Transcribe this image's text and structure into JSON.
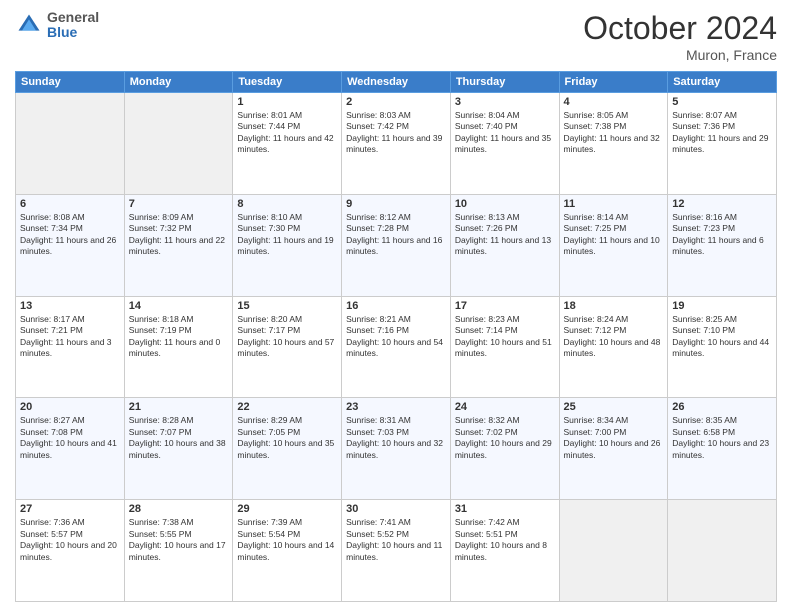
{
  "header": {
    "logo": {
      "general": "General",
      "blue": "Blue"
    },
    "title": "October 2024",
    "location": "Muron, France"
  },
  "weekdays": [
    "Sunday",
    "Monday",
    "Tuesday",
    "Wednesday",
    "Thursday",
    "Friday",
    "Saturday"
  ],
  "weeks": [
    [
      {
        "day": null,
        "sunrise": null,
        "sunset": null,
        "daylight": null
      },
      {
        "day": null,
        "sunrise": null,
        "sunset": null,
        "daylight": null
      },
      {
        "day": "1",
        "sunrise": "Sunrise: 8:01 AM",
        "sunset": "Sunset: 7:44 PM",
        "daylight": "Daylight: 11 hours and 42 minutes."
      },
      {
        "day": "2",
        "sunrise": "Sunrise: 8:03 AM",
        "sunset": "Sunset: 7:42 PM",
        "daylight": "Daylight: 11 hours and 39 minutes."
      },
      {
        "day": "3",
        "sunrise": "Sunrise: 8:04 AM",
        "sunset": "Sunset: 7:40 PM",
        "daylight": "Daylight: 11 hours and 35 minutes."
      },
      {
        "day": "4",
        "sunrise": "Sunrise: 8:05 AM",
        "sunset": "Sunset: 7:38 PM",
        "daylight": "Daylight: 11 hours and 32 minutes."
      },
      {
        "day": "5",
        "sunrise": "Sunrise: 8:07 AM",
        "sunset": "Sunset: 7:36 PM",
        "daylight": "Daylight: 11 hours and 29 minutes."
      }
    ],
    [
      {
        "day": "6",
        "sunrise": "Sunrise: 8:08 AM",
        "sunset": "Sunset: 7:34 PM",
        "daylight": "Daylight: 11 hours and 26 minutes."
      },
      {
        "day": "7",
        "sunrise": "Sunrise: 8:09 AM",
        "sunset": "Sunset: 7:32 PM",
        "daylight": "Daylight: 11 hours and 22 minutes."
      },
      {
        "day": "8",
        "sunrise": "Sunrise: 8:10 AM",
        "sunset": "Sunset: 7:30 PM",
        "daylight": "Daylight: 11 hours and 19 minutes."
      },
      {
        "day": "9",
        "sunrise": "Sunrise: 8:12 AM",
        "sunset": "Sunset: 7:28 PM",
        "daylight": "Daylight: 11 hours and 16 minutes."
      },
      {
        "day": "10",
        "sunrise": "Sunrise: 8:13 AM",
        "sunset": "Sunset: 7:26 PM",
        "daylight": "Daylight: 11 hours and 13 minutes."
      },
      {
        "day": "11",
        "sunrise": "Sunrise: 8:14 AM",
        "sunset": "Sunset: 7:25 PM",
        "daylight": "Daylight: 11 hours and 10 minutes."
      },
      {
        "day": "12",
        "sunrise": "Sunrise: 8:16 AM",
        "sunset": "Sunset: 7:23 PM",
        "daylight": "Daylight: 11 hours and 6 minutes."
      }
    ],
    [
      {
        "day": "13",
        "sunrise": "Sunrise: 8:17 AM",
        "sunset": "Sunset: 7:21 PM",
        "daylight": "Daylight: 11 hours and 3 minutes."
      },
      {
        "day": "14",
        "sunrise": "Sunrise: 8:18 AM",
        "sunset": "Sunset: 7:19 PM",
        "daylight": "Daylight: 11 hours and 0 minutes."
      },
      {
        "day": "15",
        "sunrise": "Sunrise: 8:20 AM",
        "sunset": "Sunset: 7:17 PM",
        "daylight": "Daylight: 10 hours and 57 minutes."
      },
      {
        "day": "16",
        "sunrise": "Sunrise: 8:21 AM",
        "sunset": "Sunset: 7:16 PM",
        "daylight": "Daylight: 10 hours and 54 minutes."
      },
      {
        "day": "17",
        "sunrise": "Sunrise: 8:23 AM",
        "sunset": "Sunset: 7:14 PM",
        "daylight": "Daylight: 10 hours and 51 minutes."
      },
      {
        "day": "18",
        "sunrise": "Sunrise: 8:24 AM",
        "sunset": "Sunset: 7:12 PM",
        "daylight": "Daylight: 10 hours and 48 minutes."
      },
      {
        "day": "19",
        "sunrise": "Sunrise: 8:25 AM",
        "sunset": "Sunset: 7:10 PM",
        "daylight": "Daylight: 10 hours and 44 minutes."
      }
    ],
    [
      {
        "day": "20",
        "sunrise": "Sunrise: 8:27 AM",
        "sunset": "Sunset: 7:08 PM",
        "daylight": "Daylight: 10 hours and 41 minutes."
      },
      {
        "day": "21",
        "sunrise": "Sunrise: 8:28 AM",
        "sunset": "Sunset: 7:07 PM",
        "daylight": "Daylight: 10 hours and 38 minutes."
      },
      {
        "day": "22",
        "sunrise": "Sunrise: 8:29 AM",
        "sunset": "Sunset: 7:05 PM",
        "daylight": "Daylight: 10 hours and 35 minutes."
      },
      {
        "day": "23",
        "sunrise": "Sunrise: 8:31 AM",
        "sunset": "Sunset: 7:03 PM",
        "daylight": "Daylight: 10 hours and 32 minutes."
      },
      {
        "day": "24",
        "sunrise": "Sunrise: 8:32 AM",
        "sunset": "Sunset: 7:02 PM",
        "daylight": "Daylight: 10 hours and 29 minutes."
      },
      {
        "day": "25",
        "sunrise": "Sunrise: 8:34 AM",
        "sunset": "Sunset: 7:00 PM",
        "daylight": "Daylight: 10 hours and 26 minutes."
      },
      {
        "day": "26",
        "sunrise": "Sunrise: 8:35 AM",
        "sunset": "Sunset: 6:58 PM",
        "daylight": "Daylight: 10 hours and 23 minutes."
      }
    ],
    [
      {
        "day": "27",
        "sunrise": "Sunrise: 7:36 AM",
        "sunset": "Sunset: 5:57 PM",
        "daylight": "Daylight: 10 hours and 20 minutes."
      },
      {
        "day": "28",
        "sunrise": "Sunrise: 7:38 AM",
        "sunset": "Sunset: 5:55 PM",
        "daylight": "Daylight: 10 hours and 17 minutes."
      },
      {
        "day": "29",
        "sunrise": "Sunrise: 7:39 AM",
        "sunset": "Sunset: 5:54 PM",
        "daylight": "Daylight: 10 hours and 14 minutes."
      },
      {
        "day": "30",
        "sunrise": "Sunrise: 7:41 AM",
        "sunset": "Sunset: 5:52 PM",
        "daylight": "Daylight: 10 hours and 11 minutes."
      },
      {
        "day": "31",
        "sunrise": "Sunrise: 7:42 AM",
        "sunset": "Sunset: 5:51 PM",
        "daylight": "Daylight: 10 hours and 8 minutes."
      },
      {
        "day": null,
        "sunrise": null,
        "sunset": null,
        "daylight": null
      },
      {
        "day": null,
        "sunrise": null,
        "sunset": null,
        "daylight": null
      }
    ]
  ]
}
